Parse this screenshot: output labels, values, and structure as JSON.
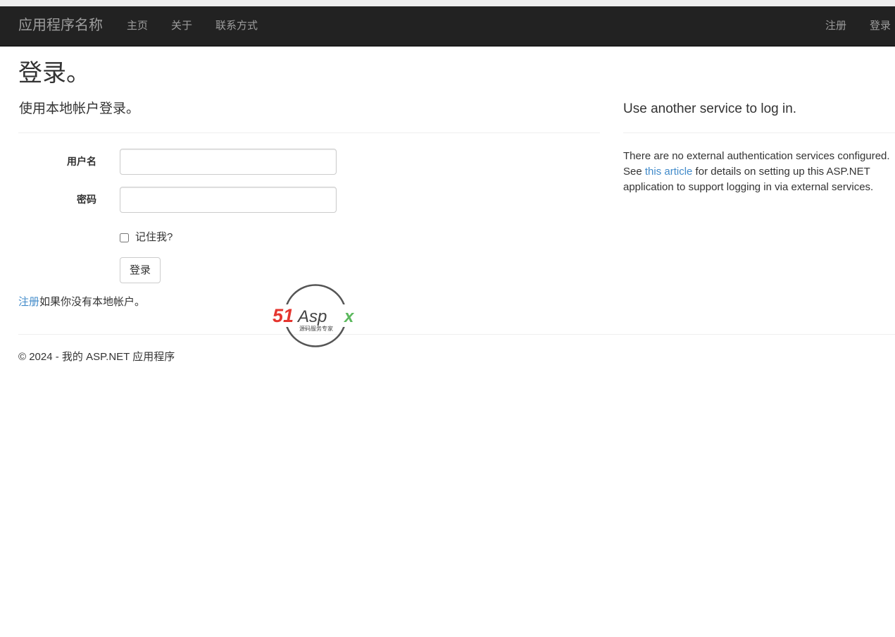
{
  "navbar": {
    "brand": "应用程序名称",
    "links": [
      "主页",
      "关于",
      "联系方式"
    ],
    "right_links": [
      "注册",
      "登录"
    ]
  },
  "page": {
    "title": "登录。"
  },
  "local_login": {
    "heading": "使用本地帐户登录。",
    "username_label": "用户名",
    "username_value": "",
    "password_label": "密码",
    "password_value": "",
    "remember_label": "记住我?",
    "remember_checked": false,
    "submit_label": "登录",
    "register_link": "注册",
    "register_suffix": "如果你没有本地帐户。"
  },
  "external_login": {
    "heading": "Use another service to log in.",
    "text_before": "There are no external authentication services configured. See ",
    "link_text": "this article",
    "text_after": " for details on setting up this ASP.NET application to support logging in via external services."
  },
  "footer": {
    "text": "© 2024 - 我的 ASP.NET 应用程序"
  },
  "watermark": {
    "brand_51": "51",
    "brand_asp": "Asp",
    "brand_x": "x",
    "tagline": "源码服务专家",
    "colors": {
      "red": "#e5352f",
      "dark": "#444444",
      "green": "#5bb85d"
    }
  },
  "theme": {
    "navbar_bg": "#222222",
    "nav_text": "#9d9d9d",
    "link": "#428bca"
  }
}
